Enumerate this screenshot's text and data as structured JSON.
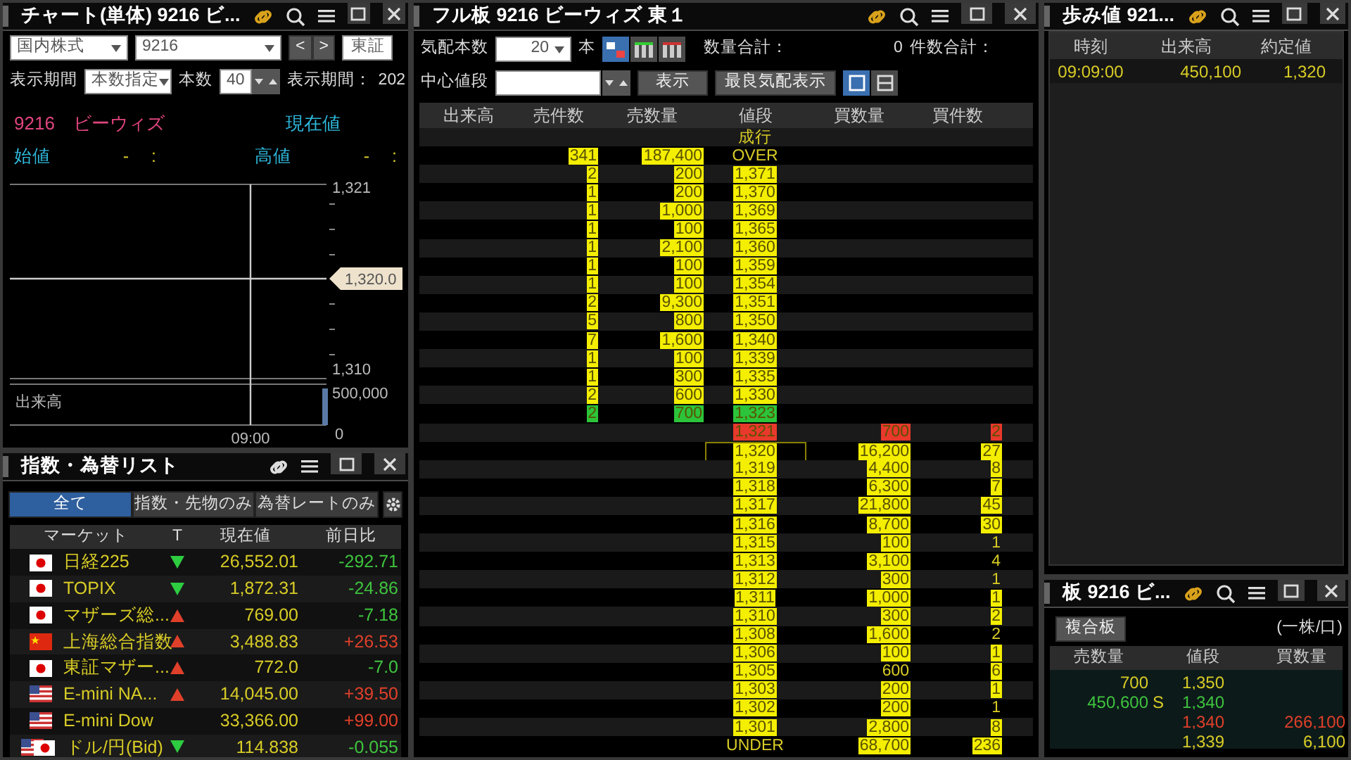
{
  "chart_pane": {
    "title": "チャート(単体) 9216 ビ...",
    "market_select": "国内株式",
    "code_select": "9216",
    "prev": "<",
    "next": ">",
    "exchange": "東証",
    "period_label": "表示期間",
    "period_select": "本数指定",
    "count_label": "本数",
    "count_value": "40",
    "period_info_label": "表示期間：",
    "period_info_value": "202",
    "stock_name": "9216　ビーウィズ",
    "current_label": "現在値",
    "open_label": "始値",
    "open_value": "-",
    "open_time": ":",
    "high_label": "高値",
    "high_value": "-",
    "high_time": ":",
    "price_labels": [
      "1,321",
      "1,310"
    ],
    "crosshair_price": "1,320.0",
    "volume_title": "出来高",
    "volume_labels": [
      "500,000",
      "0"
    ],
    "time_label": "09:00"
  },
  "index_pane": {
    "title": "指数・為替リスト",
    "tabs": [
      {
        "label": "全て",
        "selected": true
      },
      {
        "label": "指数・先物のみ",
        "selected": false
      },
      {
        "label": "為替レートのみ",
        "selected": false
      }
    ],
    "columns": [
      "マーケット",
      "T",
      "現在値",
      "前日比"
    ],
    "rows": [
      {
        "kind": "jp",
        "name": "日経225",
        "up": false,
        "down": true,
        "value": "26,552.01",
        "change": "-292.71",
        "gain": false
      },
      {
        "kind": "jp",
        "name": "TOPIX",
        "up": false,
        "down": true,
        "value": "1,872.31",
        "change": "-24.86",
        "gain": false
      },
      {
        "kind": "jp",
        "name": "マザーズ総...",
        "up": true,
        "down": false,
        "value": "769.00",
        "change": "-7.18",
        "gain": false
      },
      {
        "kind": "cn",
        "name": "上海総合指数",
        "up": true,
        "down": false,
        "value": "3,488.83",
        "change": "+26.53",
        "gain": true
      },
      {
        "kind": "jp",
        "name": "東証マザー...",
        "up": true,
        "down": false,
        "value": "772.0",
        "change": "-7.0",
        "gain": false
      },
      {
        "kind": "us",
        "name": "E-mini NA...",
        "up": true,
        "down": false,
        "value": "14,045.00",
        "change": "+39.50",
        "gain": true
      },
      {
        "kind": "us",
        "name": "E-mini Dow",
        "up": false,
        "down": false,
        "value": "33,366.00",
        "change": "+99.00",
        "gain": true
      },
      {
        "kind": "usjp",
        "name": "ドル/円(Bid)",
        "up": false,
        "down": true,
        "value": "114.838",
        "change": "-0.055",
        "gain": false
      }
    ]
  },
  "board_pane": {
    "title": "フル板 9216 ビーウィズ 東１",
    "depth_label": "気配本数",
    "depth_value": "20",
    "depth_unit": "本",
    "qty_total_label": "数量合計：",
    "qty_total_value": "0",
    "count_total_label": "件数合計：",
    "center_label": "中心値段",
    "show_button": "表示",
    "best_button": "最良気配表示",
    "layout_options": [
      {
        "selected": true
      },
      {
        "selected": false
      },
      {
        "selected": false
      }
    ],
    "view_options": [
      {
        "selected": true
      },
      {
        "selected": false
      }
    ],
    "columns": [
      "出来高",
      "売件数",
      "売数量",
      "値段",
      "買数量",
      "買件数"
    ],
    "rows": [
      {
        "price": "成行"
      },
      {
        "sell_count": "341",
        "sell_qty": "187,400",
        "price": "OVER",
        "color": "#f4ee00",
        "unmarked_price": true
      },
      {
        "sell_count": "2",
        "sell_qty": "200",
        "price": "1,371",
        "color": "#f4ee00"
      },
      {
        "sell_count": "1",
        "sell_qty": "200",
        "price": "1,370",
        "color": "#f4ee00"
      },
      {
        "sell_count": "1",
        "sell_qty": "1,000",
        "price": "1,369",
        "color": "#f4ee00"
      },
      {
        "sell_count": "1",
        "sell_qty": "100",
        "price": "1,365",
        "color": "#f4ee00"
      },
      {
        "sell_count": "1",
        "sell_qty": "2,100",
        "price": "1,360",
        "color": "#f4ee00"
      },
      {
        "sell_count": "1",
        "sell_qty": "100",
        "price": "1,359",
        "color": "#f4ee00"
      },
      {
        "sell_count": "1",
        "sell_qty": "100",
        "price": "1,354",
        "color": "#f4ee00"
      },
      {
        "sell_count": "2",
        "sell_qty": "9,300",
        "price": "1,351",
        "color": "#f4ee00"
      },
      {
        "sell_count": "5",
        "sell_qty": "800",
        "price": "1,350",
        "color": "#f4ee00"
      },
      {
        "sell_count": "7",
        "sell_qty": "1,600",
        "price": "1,340",
        "color": "#f4ee00"
      },
      {
        "sell_count": "1",
        "sell_qty": "100",
        "price": "1,339",
        "color": "#f4ee00"
      },
      {
        "sell_count": "1",
        "sell_qty": "300",
        "price": "1,335",
        "color": "#f4ee00"
      },
      {
        "sell_count": "2",
        "sell_qty": "600",
        "price": "1,330",
        "color": "#f4ee00"
      },
      {
        "sell_count": "2",
        "sell_qty": "700",
        "price": "1,323",
        "color": "#2cc43a"
      },
      {
        "price": "1,321",
        "buy_qty": "700",
        "buy_count": "2",
        "color": "#e8392c"
      },
      {
        "price": "1,320",
        "buy_qty": "16,200",
        "buy_count": "27",
        "color": "#f4ee00",
        "current": true
      },
      {
        "price": "1,319",
        "buy_qty": "4,400",
        "buy_count": "8",
        "color": "#f4ee00"
      },
      {
        "price": "1,318",
        "buy_qty": "6,300",
        "buy_count": "7",
        "color": "#f4ee00"
      },
      {
        "price": "1,317",
        "buy_qty": "21,800",
        "buy_count": "45",
        "color": "#f4ee00"
      },
      {
        "price": "1,316",
        "buy_qty": "8,700",
        "buy_count": "30",
        "color": "#f4ee00"
      },
      {
        "price": "1,315",
        "buy_qty": "100",
        "buy_count": "1",
        "color": "#f4ee00",
        "unmarked_buy_count": true
      },
      {
        "price": "1,313",
        "buy_qty": "3,100",
        "buy_count": "4",
        "color": "#f4ee00",
        "unmarked_buy_count": true
      },
      {
        "price": "1,312",
        "buy_qty": "300",
        "buy_count": "1",
        "color": "#f4ee00",
        "unmarked_buy_count": true
      },
      {
        "price": "1,311",
        "buy_qty": "1,000",
        "buy_count": "1",
        "color": "#f4ee00"
      },
      {
        "price": "1,310",
        "buy_qty": "300",
        "buy_count": "2",
        "color": "#f4ee00"
      },
      {
        "price": "1,308",
        "buy_qty": "1,600",
        "buy_count": "2",
        "color": "#f4ee00",
        "unmarked_buy_count": true
      },
      {
        "price": "1,306",
        "buy_qty": "100",
        "buy_count": "1",
        "color": "#f4ee00"
      },
      {
        "price": "1,305",
        "buy_qty": "600",
        "buy_count": "6",
        "color": "#f4ee00",
        "unmarked_buy_qty": true
      },
      {
        "price": "1,303",
        "buy_qty": "200",
        "buy_count": "1",
        "color": "#f4ee00"
      },
      {
        "price": "1,302",
        "buy_qty": "200",
        "buy_count": "1",
        "color": "#f4ee00",
        "unmarked_buy_count": true
      },
      {
        "price": "1,301",
        "buy_qty": "2,800",
        "buy_count": "8",
        "color": "#f4ee00"
      },
      {
        "price": "UNDER",
        "buy_qty": "68,700",
        "buy_count": "236",
        "color": "#f4ee00",
        "unmarked_price": true
      }
    ]
  },
  "ticks_pane": {
    "title": "歩み値 921...",
    "columns": [
      "時刻",
      "出来高",
      "約定値"
    ],
    "rows": [
      {
        "time": "09:09:00",
        "volume": "450,100",
        "price": "1,320"
      }
    ]
  },
  "mini_board_pane": {
    "title": "板 9216 ビ...",
    "mode_button": "複合板",
    "unit_note": "(一株/口)",
    "columns": [
      "売数量",
      "値段",
      "買数量"
    ],
    "rows": [
      {
        "sell_qty": "700",
        "price": "1,350",
        "color": "#d8cc26"
      },
      {
        "sell_qty": "450,600",
        "mark": "S",
        "price": "1,340",
        "color": "#3ec43e"
      },
      {
        "price": "1,340",
        "buy_qty": "266,100",
        "color": "#e0402a"
      },
      {
        "price": "1,339",
        "buy_qty": "6,100",
        "color": "#d8cc26"
      }
    ]
  }
}
